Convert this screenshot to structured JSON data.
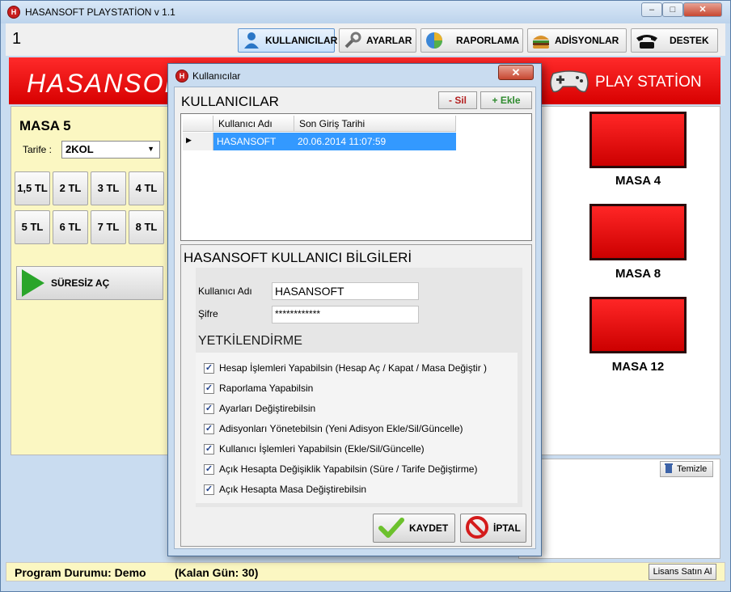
{
  "window": {
    "title": "HASANSOFT PLAYSTATİON v 1.1",
    "controls": [
      "–",
      "□",
      "✕"
    ]
  },
  "toolbar": {
    "counter": "1",
    "buttons": [
      {
        "label": "KULLANICILAR",
        "icon": "user-icon"
      },
      {
        "label": "AYARLAR",
        "icon": "wrench-icon"
      },
      {
        "label": "RAPORLAMA",
        "icon": "pie-chart-icon"
      },
      {
        "label": "ADİSYONLAR",
        "icon": "burger-icon"
      },
      {
        "label": "DESTEK",
        "icon": "telephone-icon"
      }
    ]
  },
  "banner": {
    "logo_text": "HASANSOF",
    "right_text": "PLAY STATİON"
  },
  "left": {
    "table_title": "MASA 5",
    "tarife_label": "Tarife :",
    "tarife_value": "2KOL",
    "prices": [
      "1,5 TL",
      "2 TL",
      "3 TL",
      "4 TL",
      "5 TL",
      "6 TL",
      "7 TL",
      "8 TL"
    ],
    "unlimited_label": "SÜRESİZ AÇ"
  },
  "tables": [
    "MASA 4",
    "MASA 8",
    "MASA 12"
  ],
  "log": {
    "clear_label": "Temizle"
  },
  "status": {
    "program": "Program Durumu: Demo",
    "remaining": "(Kalan Gün: 30)",
    "license_button": "Lisans Satın Al"
  },
  "dialog": {
    "title": "Kullanıcılar",
    "users_heading": "KULLANICILAR",
    "delete_label": "- Sil",
    "add_label": "+ Ekle",
    "columns": [
      "Kullanıcı Adı",
      "Son Giriş Tarihi"
    ],
    "rows": [
      {
        "name": "HASANSOFT",
        "last_login": "20.06.2014 11:07:59"
      }
    ],
    "info_heading": "HASANSOFT KULLANICI BİLGİLERİ",
    "username_label": "Kullanıcı Adı",
    "username_value": "HASANSOFT",
    "password_label": "Şifre",
    "password_value": "************",
    "permissions_heading": "YETKİLENDİRME",
    "permissions": [
      {
        "label": "Hesap İşlemleri Yapabilsin (Hesap  Aç / Kapat / Masa Değiştir )",
        "checked": true
      },
      {
        "label": "Raporlama Yapabilsin",
        "checked": true
      },
      {
        "label": "Ayarları Değiştirebilsin",
        "checked": true
      },
      {
        "label": "Adisyonları Yönetebilsin (Yeni Adisyon Ekle/Sil/Güncelle)",
        "checked": true
      },
      {
        "label": "Kullanıcı İşlemleri Yapabilsin  (Ekle/Sil/Güncelle)",
        "checked": true
      },
      {
        "label": "Açık Hesapta Değişiklik Yapabilsin (Süre / Tarife Değiştirme)",
        "checked": true
      },
      {
        "label": "Açık Hesapta Masa Değiştirebilsin",
        "checked": true
      }
    ],
    "save_label": "KAYDET",
    "cancel_label": "İPTAL"
  },
  "colors": {
    "banner_red": "#e00000",
    "panel_yellow": "#fbf7c2",
    "selection_blue": "#3399ff",
    "check_green": "#6cc12d"
  }
}
